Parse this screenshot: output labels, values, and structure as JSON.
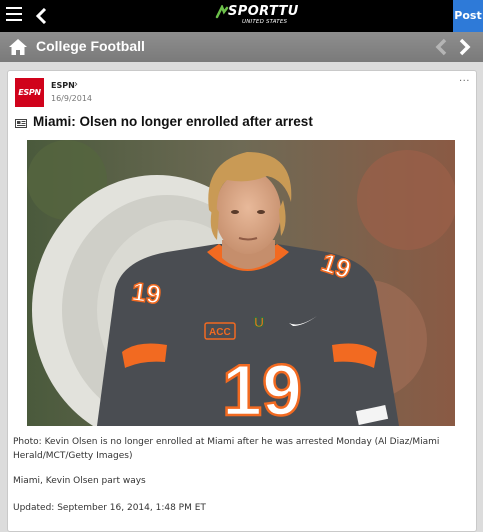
{
  "app": {
    "logo_text": "SPORTTU",
    "logo_sub": "UNITED STATES",
    "post_label": "Post"
  },
  "section": {
    "title": "College Football"
  },
  "article": {
    "source": "ESPN",
    "source_logo": "ESPN",
    "date": "16/9/2014",
    "more": "...",
    "headline": "Miami: Olsen no longer enrolled after arrest",
    "photo_jersey_number": "19",
    "photo_patch": "ACC",
    "caption": "Photo: Kevin Olsen is no longer enrolled at Miami after he was arrested Monday (Al Diaz/Miami Herald/MCT/Getty Images)",
    "summary": "Miami, Kevin Olsen part ways",
    "updated": "Updated: September 16, 2014, 1:48 PM ET"
  },
  "colors": {
    "topbar": "#000000",
    "post_button": "#2e7ad8",
    "section_bar": "#848484",
    "espn_red": "#d0021b",
    "jersey_gray": "#4a4d52",
    "jersey_orange": "#f26a21"
  },
  "icons": [
    "menu-icon",
    "back-arrow-icon",
    "home-icon",
    "chevron-left-icon",
    "chevron-right-icon",
    "article-icon",
    "more-icon"
  ]
}
